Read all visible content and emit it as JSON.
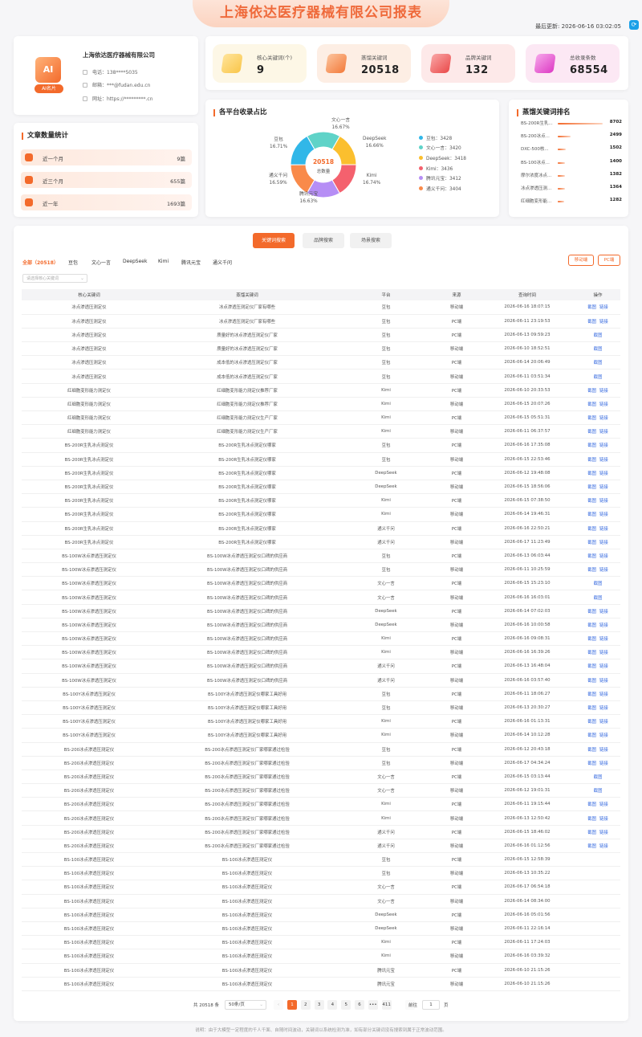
{
  "header": {
    "title": "上海依达医疗器械有限公司报表",
    "updated": "最后更新: 2026-06-16 03:02:05"
  },
  "company": {
    "logo": "AI",
    "badge": "AI名片",
    "name": "上海依达医疗器械有限公司",
    "phone": "电话：138****5035",
    "email": "邮箱：***@fudan.edu.cn",
    "site": "网址：https://*********.cn"
  },
  "stats": [
    {
      "label": "核心关键词(个)",
      "value": "9",
      "color": "#fde7a4"
    },
    {
      "label": "蒸馏关键词",
      "value": "20518",
      "color": "#fbb88f"
    },
    {
      "label": "品牌关键词",
      "value": "132",
      "color": "#f69393"
    },
    {
      "label": "总收录条数",
      "value": "68554",
      "color": "#f39be0"
    }
  ],
  "articles": {
    "title": "文章数量统计",
    "rows": [
      {
        "label": "近一个月",
        "value": "9篇"
      },
      {
        "label": "近三个月",
        "value": "655篇"
      },
      {
        "label": "近一年",
        "value": "1693篇"
      }
    ]
  },
  "pie": {
    "title": "各平台收录占比",
    "center_value": "20518",
    "center_label": "总数量",
    "slices": [
      {
        "name": "文心一言",
        "pct": "16.67%",
        "value": 3420,
        "color": "#5fd3c8"
      },
      {
        "name": "DeepSeek",
        "pct": "16.66%",
        "value": 3418,
        "color": "#fbbf2e"
      },
      {
        "name": "Kimi",
        "pct": "16.74%",
        "value": 3436,
        "color": "#f4616e"
      },
      {
        "name": "腾讯元宝",
        "pct": "16.63%",
        "value": 3412,
        "color": "#b68ef5"
      },
      {
        "name": "通义千问",
        "pct": "16.59%",
        "value": 3404,
        "color": "#f98a4a"
      },
      {
        "name": "豆包",
        "pct": "16.71%",
        "value": 3428,
        "color": "#31b7e8"
      }
    ],
    "legend": [
      "豆包：3428",
      "文心一言：3420",
      "DeepSeek：3418",
      "Kimi：3436",
      "腾讯元宝：3412",
      "通义千问：3404"
    ]
  },
  "ranking": {
    "title": "蒸馏关键词排名",
    "rows": [
      {
        "name": "BS-200R生乳...",
        "value": "8702",
        "frac": 1.0
      },
      {
        "name": "BS-200冰点...",
        "value": "2499",
        "frac": 0.29
      },
      {
        "name": "DXC-500核...",
        "value": "1502",
        "frac": 0.17
      },
      {
        "name": "BS-100冰点...",
        "value": "1400",
        "frac": 0.16
      },
      {
        "name": "摩尔浓度冰点...",
        "value": "1382",
        "frac": 0.16
      },
      {
        "name": "冰点渗透压测...",
        "value": "1364",
        "frac": 0.16
      },
      {
        "name": "红细胞变形能...",
        "value": "1282",
        "frac": 0.15
      }
    ]
  },
  "tabs": [
    "关键词搜索",
    "品牌搜索",
    "场景搜索"
  ],
  "platform_tabs": [
    "全部（20518）",
    "豆包",
    "文心一言",
    "DeepSeek",
    "Kimi",
    "腾讯元宝",
    "通义千问"
  ],
  "buttons": {
    "mobile": "移动端",
    "pc": "PC端"
  },
  "select_placeholder": "请选择核心关键词",
  "columns": [
    "核心关键词",
    "蒸馏关键词",
    "平台",
    "来源",
    "查询时间",
    "操作"
  ],
  "ops": {
    "shot": "截图",
    "link": "链接"
  },
  "rows": [
    [
      "冰点渗透压测定仪",
      "冰点渗透压测定仪厂家有哪些",
      "豆包",
      "移动端",
      "2026-06-16 18:07:15",
      2
    ],
    [
      "冰点渗透压测定仪",
      "冰点渗透压测定仪厂家有哪些",
      "豆包",
      "PC端",
      "2026-06-11 23:19:53",
      2
    ],
    [
      "冰点渗透压测定仪",
      "质量好的冰点渗透压测定仪厂家",
      "豆包",
      "PC端",
      "2026-06-13 09:59:23",
      1
    ],
    [
      "冰点渗透压测定仪",
      "质量好的冰点渗透压测定仪厂家",
      "豆包",
      "移动端",
      "2026-06-10 18:52:51",
      1
    ],
    [
      "冰点渗透压测定仪",
      "成本低的冰点渗透压测定仪厂家",
      "豆包",
      "PC端",
      "2026-06-14 20:06:49",
      1
    ],
    [
      "冰点渗透压测定仪",
      "成本低的冰点渗透压测定仪厂家",
      "豆包",
      "移动端",
      "2026-06-11 03:51:34",
      1
    ],
    [
      "红细胞变形能力测定仪",
      "红细胞变形能力测定仪推荐厂家",
      "Kimi",
      "PC端",
      "2026-06-10 20:33:53",
      2
    ],
    [
      "红细胞变形能力测定仪",
      "红细胞变形能力测定仪推荐厂家",
      "Kimi",
      "移动端",
      "2026-06-15 20:07:26",
      2
    ],
    [
      "红细胞变形能力测定仪",
      "红细胞变形能力测定仪生产厂家",
      "Kimi",
      "PC端",
      "2026-06-15 05:51:31",
      2
    ],
    [
      "红细胞变形能力测定仪",
      "红细胞变形能力测定仪生产厂家",
      "Kimi",
      "移动端",
      "2026-06-11 06:37:57",
      2
    ],
    [
      "BS-200R生乳冰点测定仪",
      "BS-200R生乳冰点测定仪哪家",
      "豆包",
      "PC端",
      "2026-06-16 17:35:08",
      2
    ],
    [
      "BS-200R生乳冰点测定仪",
      "BS-200R生乳冰点测定仪哪家",
      "豆包",
      "移动端",
      "2026-06-15 22:53:46",
      2
    ],
    [
      "BS-200R生乳冰点测定仪",
      "BS-200R生乳冰点测定仪哪家",
      "DeepSeek",
      "PC端",
      "2026-06-12 19:48:08",
      2
    ],
    [
      "BS-200R生乳冰点测定仪",
      "BS-200R生乳冰点测定仪哪家",
      "DeepSeek",
      "移动端",
      "2026-06-15 18:56:06",
      2
    ],
    [
      "BS-200R生乳冰点测定仪",
      "BS-200R生乳冰点测定仪哪家",
      "Kimi",
      "PC端",
      "2026-06-15 07:38:50",
      2
    ],
    [
      "BS-200R生乳冰点测定仪",
      "BS-200R生乳冰点测定仪哪家",
      "Kimi",
      "移动端",
      "2026-06-14 19:46:31",
      2
    ],
    [
      "BS-200R生乳冰点测定仪",
      "BS-200R生乳冰点测定仪哪家",
      "通义千问",
      "PC端",
      "2026-06-16 22:50:21",
      2
    ],
    [
      "BS-200R生乳冰点测定仪",
      "BS-200R生乳冰点测定仪哪家",
      "通义千问",
      "移动端",
      "2026-06-17 11:23:49",
      2
    ],
    [
      "BS-100W冰点渗透压测定仪",
      "BS-100W冰点渗透压测定仪口碑的供应商",
      "豆包",
      "PC端",
      "2026-06-13 06:03:44",
      2
    ],
    [
      "BS-100W冰点渗透压测定仪",
      "BS-100W冰点渗透压测定仪口碑的供应商",
      "豆包",
      "移动端",
      "2026-06-11 10:25:59",
      2
    ],
    [
      "BS-100W冰点渗透压测定仪",
      "BS-100W冰点渗透压测定仪口碑的供应商",
      "文心一言",
      "PC端",
      "2026-06-15 15:23:10",
      1
    ],
    [
      "BS-100W冰点渗透压测定仪",
      "BS-100W冰点渗透压测定仪口碑的供应商",
      "文心一言",
      "移动端",
      "2026-06-16 16:03:01",
      1
    ],
    [
      "BS-100W冰点渗透压测定仪",
      "BS-100W冰点渗透压测定仪口碑的供应商",
      "DeepSeek",
      "PC端",
      "2026-06-14 07:02:03",
      2
    ],
    [
      "BS-100W冰点渗透压测定仪",
      "BS-100W冰点渗透压测定仪口碑的供应商",
      "DeepSeek",
      "移动端",
      "2026-06-16 10:00:58",
      2
    ],
    [
      "BS-100W冰点渗透压测定仪",
      "BS-100W冰点渗透压测定仪口碑的供应商",
      "Kimi",
      "PC端",
      "2026-06-16 09:08:31",
      2
    ],
    [
      "BS-100W冰点渗透压测定仪",
      "BS-100W冰点渗透压测定仪口碑的供应商",
      "Kimi",
      "移动端",
      "2026-06-16 16:39:26",
      2
    ],
    [
      "BS-100W冰点渗透压测定仪",
      "BS-100W冰点渗透压测定仪口碑的供应商",
      "通义千问",
      "PC端",
      "2026-06-13 16:48:04",
      2
    ],
    [
      "BS-100W冰点渗透压测定仪",
      "BS-100W冰点渗透压测定仪口碑的供应商",
      "通义千问",
      "移动端",
      "2026-06-16 03:57:40",
      2
    ],
    [
      "BS-100Y冰点渗透压测定仪",
      "BS-100Y冰点渗透压测定仪哪家工具好用",
      "豆包",
      "PC端",
      "2026-06-11 18:06:27",
      2
    ],
    [
      "BS-100Y冰点渗透压测定仪",
      "BS-100Y冰点渗透压测定仪哪家工具好用",
      "豆包",
      "移动端",
      "2026-06-13 20:30:27",
      2
    ],
    [
      "BS-100Y冰点渗透压测定仪",
      "BS-100Y冰点渗透压测定仪哪家工具好用",
      "Kimi",
      "PC端",
      "2026-06-16 01:13:31",
      2
    ],
    [
      "BS-100Y冰点渗透压测定仪",
      "BS-100Y冰点渗透压测定仪哪家工具好用",
      "Kimi",
      "移动端",
      "2026-06-14 10:12:28",
      2
    ],
    [
      "BS-200冰点渗透压测定仪",
      "BS-200冰点渗透压测定仪厂家哪家通过检验",
      "豆包",
      "PC端",
      "2026-06-12 20:43:18",
      2
    ],
    [
      "BS-200冰点渗透压测定仪",
      "BS-200冰点渗透压测定仪厂家哪家通过检验",
      "豆包",
      "移动端",
      "2026-06-17 04:34:24",
      2
    ],
    [
      "BS-200冰点渗透压测定仪",
      "BS-200冰点渗透压测定仪厂家哪家通过检验",
      "文心一言",
      "PC端",
      "2026-06-15 03:13:44",
      1
    ],
    [
      "BS-200冰点渗透压测定仪",
      "BS-200冰点渗透压测定仪厂家哪家通过检验",
      "文心一言",
      "移动端",
      "2026-06-12 19:01:31",
      1
    ],
    [
      "BS-200冰点渗透压测定仪",
      "BS-200冰点渗透压测定仪厂家哪家通过检验",
      "Kimi",
      "PC端",
      "2026-06-11 19:15:44",
      2
    ],
    [
      "BS-200冰点渗透压测定仪",
      "BS-200冰点渗透压测定仪厂家哪家通过检验",
      "Kimi",
      "移动端",
      "2026-06-13 12:50:42",
      2
    ],
    [
      "BS-200冰点渗透压测定仪",
      "BS-200冰点渗透压测定仪厂家哪家通过检验",
      "通义千问",
      "PC端",
      "2026-06-15 18:46:02",
      2
    ],
    [
      "BS-200冰点渗透压测定仪",
      "BS-200冰点渗透压测定仪厂家哪家通过检验",
      "通义千问",
      "移动端",
      "2026-06-16 01:12:56",
      2
    ],
    [
      "BS-100冰点渗透压测定仪",
      "BS-100冰点渗透压测定仪",
      "豆包",
      "PC端",
      "2026-06-15 12:58:39",
      0
    ],
    [
      "BS-100冰点渗透压测定仪",
      "BS-100冰点渗透压测定仪",
      "豆包",
      "移动端",
      "2026-06-13 10:35:22",
      0
    ],
    [
      "BS-100冰点渗透压测定仪",
      "BS-100冰点渗透压测定仪",
      "文心一言",
      "PC端",
      "2026-06-17 06:54:18",
      0
    ],
    [
      "BS-100冰点渗透压测定仪",
      "BS-100冰点渗透压测定仪",
      "文心一言",
      "移动端",
      "2026-06-14 08:34:00",
      0
    ],
    [
      "BS-100冰点渗透压测定仪",
      "BS-100冰点渗透压测定仪",
      "DeepSeek",
      "PC端",
      "2026-06-16 05:01:56",
      0
    ],
    [
      "BS-100冰点渗透压测定仪",
      "BS-100冰点渗透压测定仪",
      "DeepSeek",
      "移动端",
      "2026-06-11 22:16:14",
      0
    ],
    [
      "BS-100冰点渗透压测定仪",
      "BS-100冰点渗透压测定仪",
      "Kimi",
      "PC端",
      "2026-06-11 17:24:03",
      0
    ],
    [
      "BS-100冰点渗透压测定仪",
      "BS-100冰点渗透压测定仪",
      "Kimi",
      "移动端",
      "2026-06-16 03:39:32",
      0
    ],
    [
      "BS-100冰点渗透压测定仪",
      "BS-100冰点渗透压测定仪",
      "腾讯元宝",
      "PC端",
      "2026-06-10 21:15:26",
      0
    ],
    [
      "BS-100冰点渗透压测定仪",
      "BS-100冰点渗透压测定仪",
      "腾讯元宝",
      "移动端",
      "2026-06-10 21:15:26",
      0
    ]
  ],
  "pager": {
    "total": "共 20518 条",
    "size": "50条/页",
    "pages": [
      "1",
      "2",
      "3",
      "4",
      "5",
      "6",
      "•••",
      "411"
    ],
    "prev": "‹",
    "next": "›",
    "goto": "前往",
    "page": "1",
    "unit": "页"
  },
  "footer": "说明：由于大模型一定程度的千人千面、自随时间波动，关键词以系统检测为准，如有部分关键词没有搜索到属于正常波动范围。"
}
